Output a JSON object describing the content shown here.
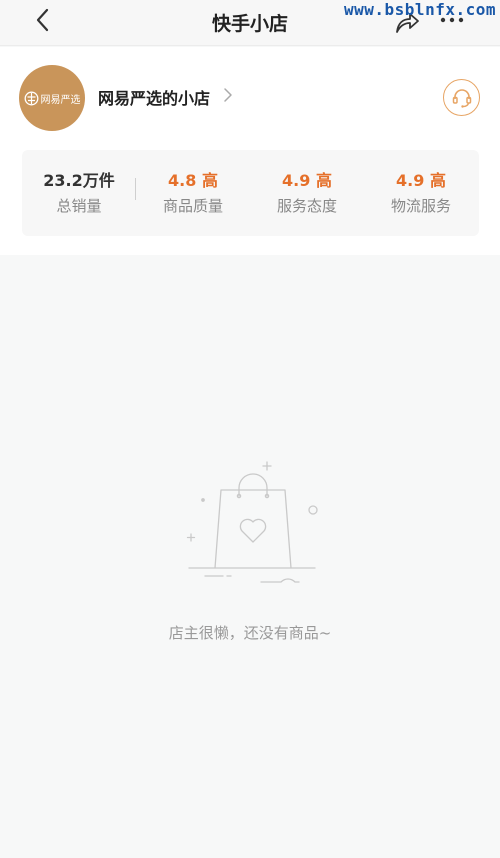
{
  "header": {
    "title": "快手小店",
    "watermark": "www.bsblnfx.com"
  },
  "shop": {
    "avatar_text": "网易严选",
    "name": "网易严选的小店",
    "accent_color": "#e7a565",
    "avatar_color": "#c9955a"
  },
  "stats": [
    {
      "value": "23.2万件",
      "label": "总销量",
      "color": "#333333"
    },
    {
      "value": "4.8 高",
      "label": "商品质量",
      "color": "#e5702a"
    },
    {
      "value": "4.9 高",
      "label": "服务态度",
      "color": "#e5702a"
    },
    {
      "value": "4.9 高",
      "label": "物流服务",
      "color": "#e5702a"
    }
  ],
  "empty_state": {
    "icon": "shopping-bag-heart-icon",
    "message": "店主很懒，还没有商品~"
  }
}
